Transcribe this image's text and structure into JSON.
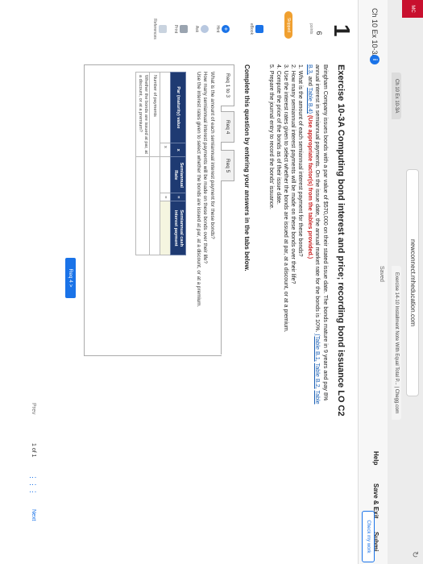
{
  "browser": {
    "url": "newconnect.mheducation.com",
    "tab_active": "Ch 10 Ex 10-3A",
    "tab_other": "Exercise 14-10 Installment Note With Equal Total P... | Chegg.com"
  },
  "header": {
    "chapter_title": "Ch 10 Ex 10-3A",
    "info_icon": "i",
    "saved": "Saved",
    "help": "Help",
    "save_exit": "Save & Exit",
    "submit": "Submi",
    "check_my_work": "Check my work"
  },
  "brand": {
    "label": "MC"
  },
  "question": {
    "number": "1",
    "points_value": "6",
    "points_label": "points",
    "status": "Skipped"
  },
  "sidebar": {
    "ebook": "eBook",
    "hint": "Hint",
    "hint_icon": "+",
    "ask": "Ask",
    "print": "Print",
    "references": "References"
  },
  "exercise": {
    "title": "Exercise 10-3A Computing bond interest and price; recording bond issuance LO C2",
    "intro_text": "Bringham Company issues bonds with a par value of $570,000 on their stated issue date. The bonds mature in 9 years and pay 8% annual interest in semiannual payments. On the issue date, the annual market rate for the bonds is 10%.",
    "table_links": [
      "(Table B.1,",
      "Table B.2,",
      "Table B.3,",
      "and",
      "Table B.4)"
    ],
    "factors_note": "(Use appropriate factor(s) from the tables provided.)",
    "questions": [
      "1. What is the amount of each semiannual interest payment for these bonds?",
      "2. How many semiannual interest payments will be made on these bonds over their life?",
      "3. Use the interest rates given to select whether the bonds are issued at par, at a discount, or at a premium.",
      "4. Compute the price of the bonds as of their issue date.",
      "5. Prepare the journal entry to record the bonds' issuance."
    ],
    "complete_prompt": "Complete this question by entering your answers in the tabs below."
  },
  "tabs": [
    "Req 1 to 3",
    "Req 4",
    "Req 5"
  ],
  "panel": {
    "q1": "What is the amount of each semiannual interest payment for these bonds?",
    "q2": "How many semiannual interest payments will be made on these bonds over their life?",
    "q3": "Use the interest rates given to select whether the bonds are issued at par, at a discount, or at a premium.",
    "table_headers": [
      "Par (maturity) value",
      "Semiannual Rate",
      "Semiannual cash interest payment"
    ],
    "row_labels": [
      "Number of payments",
      "Whether the bonds are issued at par, at a discount, or at a premium?"
    ],
    "operator": "x",
    "equals": "="
  },
  "nav": {
    "req_button": "Req 4  >",
    "prev": "Prev",
    "page_current": "1",
    "page_of": "of",
    "page_total": "1",
    "grid_icon": "⋮⋮⋮",
    "next": "Next"
  }
}
